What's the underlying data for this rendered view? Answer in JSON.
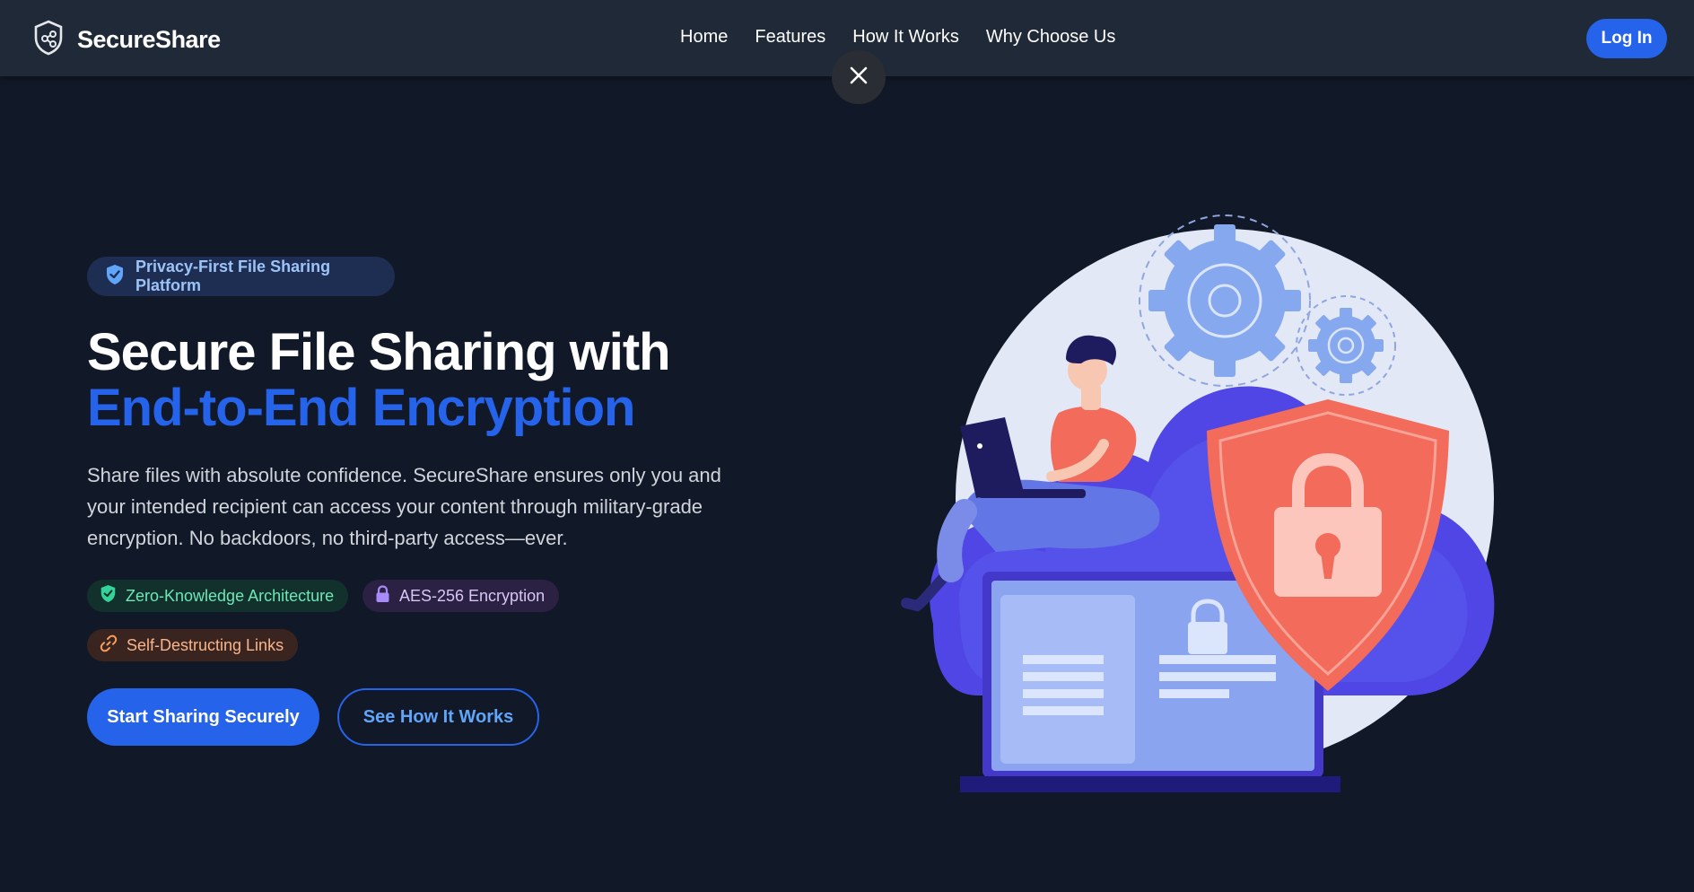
{
  "nav": {
    "brand": "SecureShare",
    "brand_icon": "shield-share-icon",
    "links": [
      "Home",
      "Features",
      "How It Works",
      "Why Choose Us"
    ],
    "login_label": "Log In",
    "close_icon": "close-icon"
  },
  "hero": {
    "badge": "Privacy-First File Sharing Platform",
    "badge_icon": "shield-check-icon",
    "title_line1": "Secure File Sharing with",
    "title_line2": "End-to-End Encryption",
    "description": "Share files with absolute confidence. SecureShare ensures only you and your intended recipient can access your content through military-grade encryption. No backdoors, no third-party access—ever.",
    "features": [
      {
        "label": "Zero-Knowledge Architecture",
        "icon": "shield-check-icon"
      },
      {
        "label": "AES-256 Encryption",
        "icon": "lock-icon"
      },
      {
        "label": "Self-Destructing Links",
        "icon": "link-icon"
      }
    ],
    "primary_cta": "Start Sharing Securely",
    "secondary_cta": "See How It Works"
  },
  "colors": {
    "background": "#111827",
    "navbar": "#1f2937",
    "accent": "#2563eb",
    "shield": "#f26b5b",
    "cloud": "#4f46e5"
  },
  "illustration": {
    "description_icon": "secure-cloud-illustration"
  }
}
